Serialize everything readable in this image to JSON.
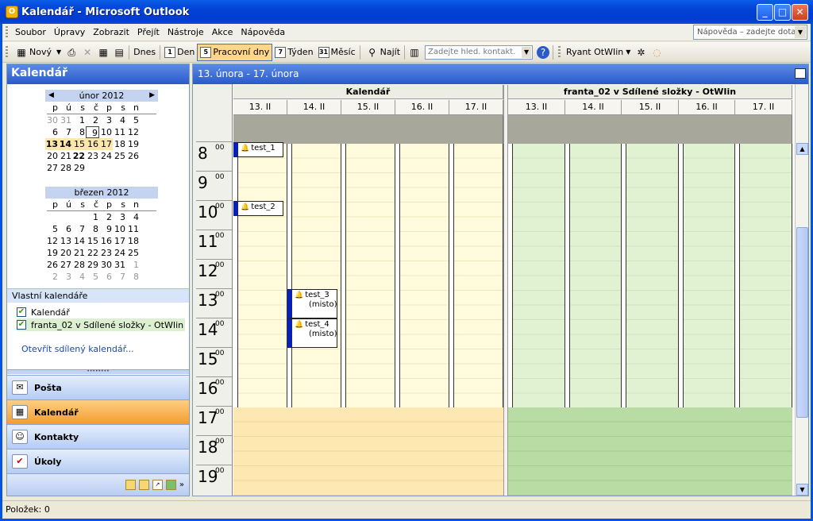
{
  "window": {
    "title": "Kalendář - Microsoft Outlook",
    "minimize": "_",
    "maximize": "□",
    "close": "✕"
  },
  "menu": {
    "items": [
      "Soubor",
      "Úpravy",
      "Zobrazit",
      "Přejít",
      "Nástroje",
      "Akce",
      "Nápověda"
    ],
    "help_placeholder": "Nápověda – zadejte dotaz"
  },
  "toolbar": {
    "new": "Nový",
    "today": "Dnes",
    "day": "Den",
    "day_num": "1",
    "workweek": "Pracovní dny",
    "workweek_num": "5",
    "week": "Týden",
    "week_num": "7",
    "month": "Měsíc",
    "month_num": "31",
    "find": "Najít",
    "contact_placeholder": "Zadejte hled. kontakt.",
    "user": "Ryant OtWIin"
  },
  "nav": {
    "title": "Kalendář",
    "cal1": {
      "month": "únor 2012",
      "dow": [
        "p",
        "ú",
        "s",
        "č",
        "p",
        "s",
        "n"
      ],
      "rows": [
        [
          "30",
          "31",
          "1",
          "2",
          "3",
          "4",
          "5"
        ],
        [
          "6",
          "7",
          "8",
          "9",
          "10",
          "11",
          "12"
        ],
        [
          "13",
          "14",
          "15",
          "16",
          "17",
          "18",
          "19"
        ],
        [
          "20",
          "21",
          "22",
          "23",
          "24",
          "25",
          "26"
        ],
        [
          "27",
          "28",
          "29",
          "",
          "",
          "",
          ""
        ]
      ]
    },
    "cal2": {
      "month": "březen 2012",
      "dow": [
        "p",
        "ú",
        "s",
        "č",
        "p",
        "s",
        "n"
      ],
      "rows": [
        [
          "",
          "",
          "",
          "1",
          "2",
          "3",
          "4"
        ],
        [
          "5",
          "6",
          "7",
          "8",
          "9",
          "10",
          "11"
        ],
        [
          "12",
          "13",
          "14",
          "15",
          "16",
          "17",
          "18"
        ],
        [
          "19",
          "20",
          "21",
          "22",
          "23",
          "24",
          "25"
        ],
        [
          "26",
          "27",
          "28",
          "29",
          "30",
          "31",
          "1"
        ],
        [
          "2",
          "3",
          "4",
          "5",
          "6",
          "7",
          "8"
        ]
      ]
    },
    "own_calendars": "Vlastní kalendáře",
    "calendars": [
      "Kalendář",
      "franta_02 v Sdílené složky - OtWIin"
    ],
    "open_shared": "Otevřít sdílený kalendář...",
    "buttons": [
      "Pošta",
      "Kalendář",
      "Kontakty",
      "Úkoly"
    ]
  },
  "main": {
    "range": "13. února - 17. února",
    "groups": [
      "Kalendář",
      "franta_02 v Sdílené složky - OtWIin"
    ],
    "days": [
      "13. II",
      "14. II",
      "15. II",
      "16. II",
      "17. II"
    ],
    "hours": [
      "8",
      "9",
      "10",
      "11",
      "12",
      "13",
      "14",
      "15",
      "16",
      "17",
      "18",
      "19"
    ],
    "minutes": "00",
    "appointments": [
      {
        "title": "test_1",
        "sub": ""
      },
      {
        "title": "test_2",
        "sub": ""
      },
      {
        "title": "test_3",
        "sub": "(misto)"
      },
      {
        "title": "test_4",
        "sub": "(misto)"
      }
    ]
  },
  "status": {
    "items": "Položek: 0"
  }
}
